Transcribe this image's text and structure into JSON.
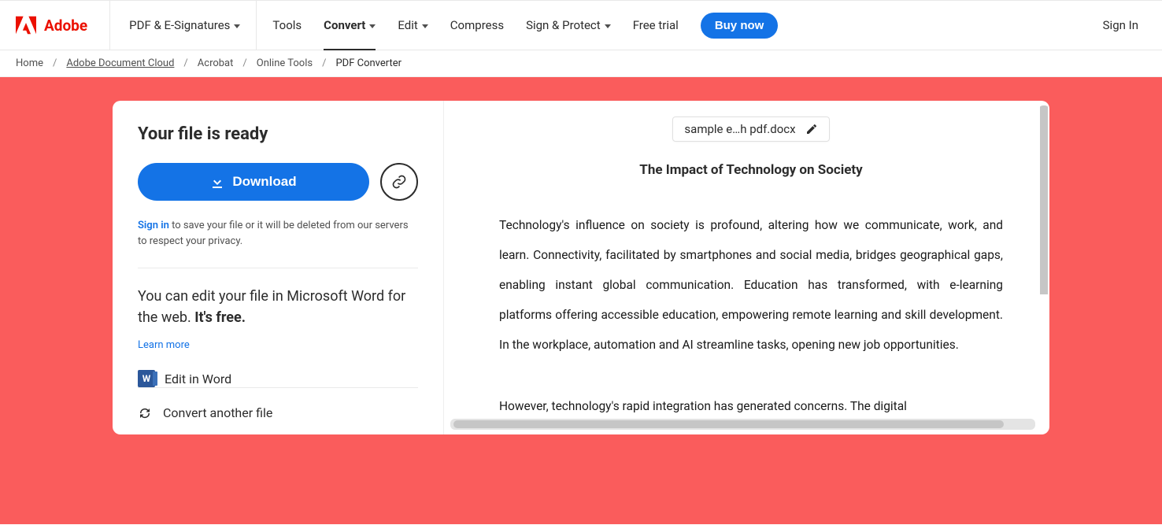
{
  "header": {
    "brand": "Adobe",
    "nav": {
      "pdf_sign": "PDF & E-Signatures",
      "tools": "Tools",
      "convert": "Convert",
      "edit": "Edit",
      "compress": "Compress",
      "sign_protect": "Sign & Protect",
      "free_trial": "Free trial",
      "buy_now": "Buy now"
    },
    "sign_in": "Sign In"
  },
  "breadcrumbs": {
    "home": "Home",
    "adc": "Adobe Document Cloud",
    "acrobat": "Acrobat",
    "online": "Online Tools",
    "current": "PDF Converter"
  },
  "left": {
    "title": "Your file is ready",
    "download": "Download",
    "note_signin": "Sign in",
    "note_rest": " to save your file or it will be deleted from our servers to respect your privacy.",
    "edit_blurb_a": "You can edit your file in Microsoft Word for the web. ",
    "edit_blurb_b": "It's free.",
    "learn_more": "Learn more",
    "edit_in_word": "Edit in Word",
    "convert_another": "Convert another file"
  },
  "preview": {
    "filename": "sample e…h pdf.docx",
    "doc_title": "The Impact of Technology on Society",
    "p1": "Technology's influence on society is profound, altering how we communicate, work, and learn. Connectivity, facilitated by smartphones and social media, bridges geographical gaps, enabling instant global communication. Education has transformed, with e-learning platforms offering accessible education, empowering remote learning and skill development. In the workplace, automation and AI streamline tasks, opening new job opportunities.",
    "p2": "However, technology's rapid integration has generated concerns. The digital"
  }
}
